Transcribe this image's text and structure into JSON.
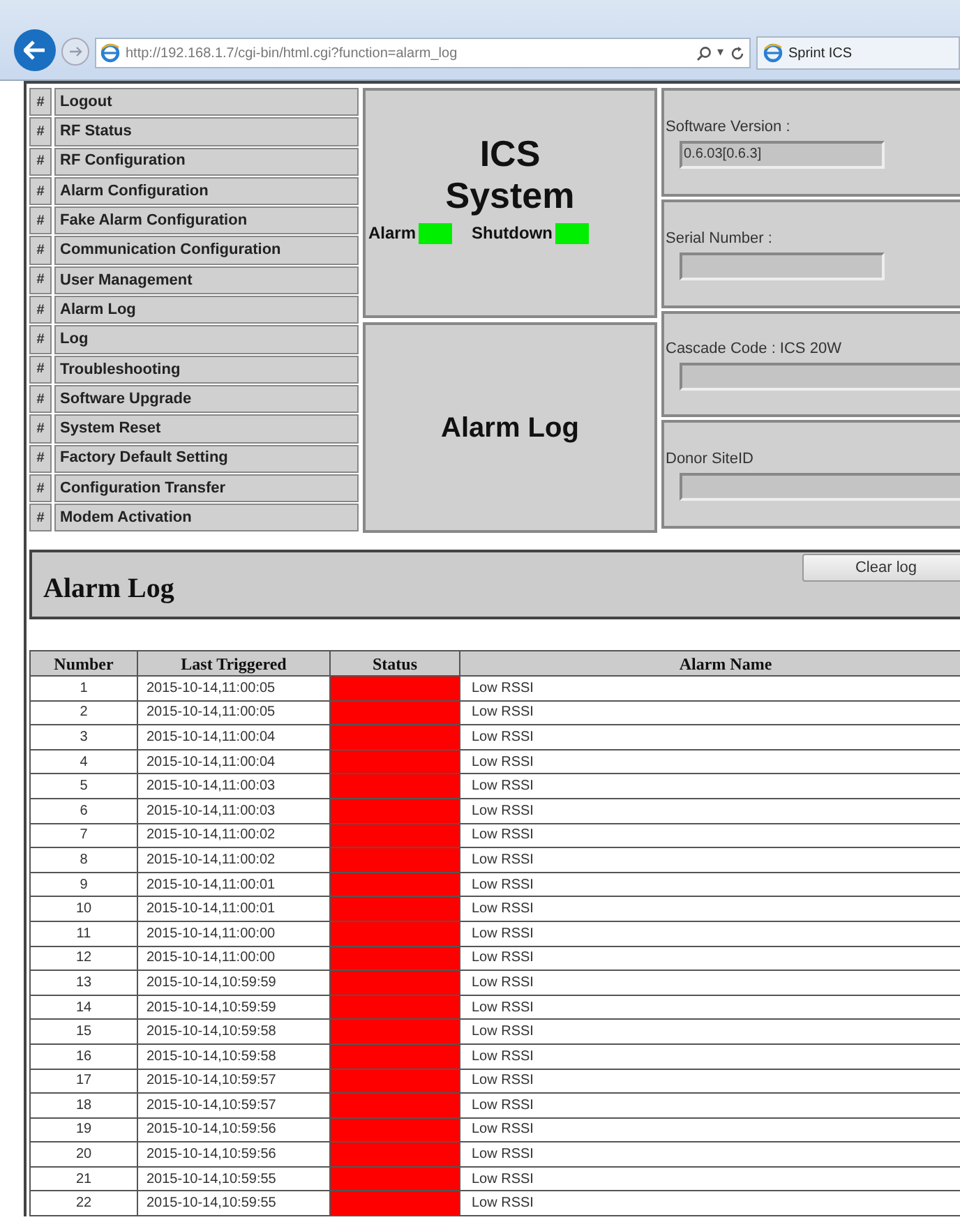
{
  "browser": {
    "url": "http://192.168.1.7/cgi-bin/html.cgi?function=alarm_log",
    "tab_title": "Sprint ICS",
    "search_dropdown": "▾"
  },
  "menu": [
    {
      "marker": "#",
      "label": "Logout"
    },
    {
      "marker": "#",
      "label": "RF Status"
    },
    {
      "marker": "#",
      "label": "RF Configuration"
    },
    {
      "marker": "#",
      "label": "Alarm Configuration"
    },
    {
      "marker": "#",
      "label": "Fake Alarm Configuration"
    },
    {
      "marker": "#",
      "label": "Communication Configuration"
    },
    {
      "marker": "#",
      "label": "User Management"
    },
    {
      "marker": "#",
      "label": "Alarm Log"
    },
    {
      "marker": "#",
      "label": "Log"
    },
    {
      "marker": "#",
      "label": "Troubleshooting"
    },
    {
      "marker": "#",
      "label": "Software Upgrade"
    },
    {
      "marker": "#",
      "label": "System Reset"
    },
    {
      "marker": "#",
      "label": "Factory Default Setting"
    },
    {
      "marker": "#",
      "label": "Configuration Transfer"
    },
    {
      "marker": "#",
      "label": "Modem Activation"
    }
  ],
  "system": {
    "title_line_1": "ICS",
    "title_line_2": "System",
    "indicators": [
      {
        "label": "Alarm",
        "color": "#00ee00"
      },
      {
        "label": "Shutdown",
        "color": "#00ee00"
      }
    ]
  },
  "page_title": "Alarm Log",
  "info": [
    {
      "label": "Software Version :",
      "value": "0.6.03[0.6.3]"
    },
    {
      "label": "Serial Number :"
    },
    {
      "label": "Cascade Code : ICS 20W"
    },
    {
      "label": "Donor SiteID"
    }
  ],
  "log": {
    "title": "Alarm Log",
    "clear_button": "Clear log"
  },
  "table": {
    "columns": [
      "Number",
      "Last Triggered",
      "Status",
      "Alarm Name"
    ],
    "rows": [
      {
        "number": "1",
        "time": "2015-10-14,11:00:05",
        "color": "#ff0000",
        "name": "Low RSSI"
      },
      {
        "number": "2",
        "time": "2015-10-14,11:00:05",
        "color": "#ff0000",
        "name": "Low RSSI"
      },
      {
        "number": "3",
        "time": "2015-10-14,11:00:04",
        "color": "#ff0000",
        "name": "Low RSSI"
      },
      {
        "number": "4",
        "time": "2015-10-14,11:00:04",
        "color": "#ff0000",
        "name": "Low RSSI"
      },
      {
        "number": "5",
        "time": "2015-10-14,11:00:03",
        "color": "#ff0000",
        "name": "Low RSSI"
      },
      {
        "number": "6",
        "time": "2015-10-14,11:00:03",
        "color": "#ff0000",
        "name": "Low RSSI"
      },
      {
        "number": "7",
        "time": "2015-10-14,11:00:02",
        "color": "#ff0000",
        "name": "Low RSSI"
      },
      {
        "number": "8",
        "time": "2015-10-14,11:00:02",
        "color": "#ff0000",
        "name": "Low RSSI"
      },
      {
        "number": "9",
        "time": "2015-10-14,11:00:01",
        "color": "#ff0000",
        "name": "Low RSSI"
      },
      {
        "number": "10",
        "time": "2015-10-14,11:00:01",
        "color": "#ff0000",
        "name": "Low RSSI"
      },
      {
        "number": "11",
        "time": "2015-10-14,11:00:00",
        "color": "#ff0000",
        "name": "Low RSSI"
      },
      {
        "number": "12",
        "time": "2015-10-14,11:00:00",
        "color": "#ff0000",
        "name": "Low RSSI"
      },
      {
        "number": "13",
        "time": "2015-10-14,10:59:59",
        "color": "#ff0000",
        "name": "Low RSSI"
      },
      {
        "number": "14",
        "time": "2015-10-14,10:59:59",
        "color": "#ff0000",
        "name": "Low RSSI"
      },
      {
        "number": "15",
        "time": "2015-10-14,10:59:58",
        "color": "#ff0000",
        "name": "Low RSSI"
      },
      {
        "number": "16",
        "time": "2015-10-14,10:59:58",
        "color": "#ff0000",
        "name": "Low RSSI"
      },
      {
        "number": "17",
        "time": "2015-10-14,10:59:57",
        "color": "#ff0000",
        "name": "Low RSSI"
      },
      {
        "number": "18",
        "time": "2015-10-14,10:59:57",
        "color": "#ff0000",
        "name": "Low RSSI"
      },
      {
        "number": "19",
        "time": "2015-10-14,10:59:56",
        "color": "#ff0000",
        "name": "Low RSSI"
      },
      {
        "number": "20",
        "time": "2015-10-14,10:59:56",
        "color": "#ff0000",
        "name": "Low RSSI"
      },
      {
        "number": "21",
        "time": "2015-10-14,10:59:55",
        "color": "#ff0000",
        "name": "Low RSSI"
      },
      {
        "number": "22",
        "time": "2015-10-14,10:59:55",
        "color": "#ff0000",
        "name": "Low RSSI"
      }
    ]
  }
}
